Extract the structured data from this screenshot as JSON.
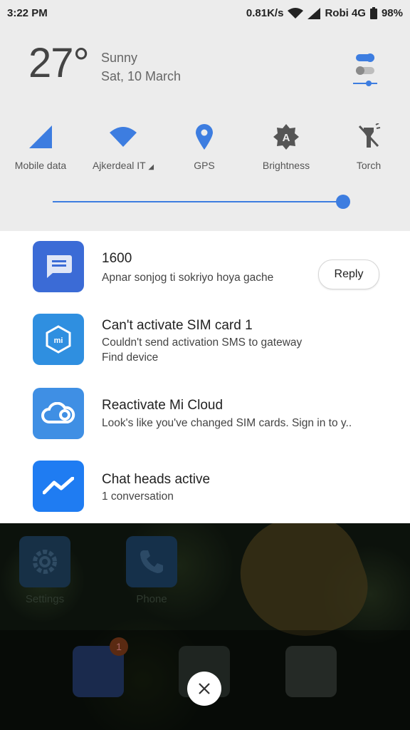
{
  "status_bar": {
    "time": "3:22 PM",
    "net_speed": "0.81K/s",
    "carrier": "Robi 4G",
    "battery": "98%"
  },
  "weather": {
    "temperature": "27°",
    "condition": "Sunny",
    "date": "Sat, 10 March"
  },
  "quick_settings": [
    {
      "label": "Mobile data",
      "icon": "mobile-data-icon"
    },
    {
      "label": "Ajkerdeal IT",
      "icon": "wifi-icon"
    },
    {
      "label": "GPS",
      "icon": "location-pin-icon"
    },
    {
      "label": "Brightness",
      "icon": "auto-brightness-icon"
    },
    {
      "label": "Torch",
      "icon": "torch-icon"
    }
  ],
  "brightness": {
    "level": 0.97,
    "accent": "#3d7de0"
  },
  "notifications": [
    {
      "title": "1600",
      "text": "Apnar sonjog ti sokriyo hoya gache",
      "action": "Reply",
      "icon": "messages-icon",
      "color": "#3b6bd6"
    },
    {
      "title": "Can't activate SIM card 1",
      "text": "Couldn't send activation SMS to gateway",
      "text2": "Find device",
      "icon": "mi-icon",
      "color": "#2f8fe0"
    },
    {
      "title": "Reactivate Mi Cloud",
      "text": "Look's like you've changed SIM cards. Sign in to y..",
      "icon": "cloud-icon",
      "color": "#3f8fe4"
    },
    {
      "title": "Chat heads active",
      "text": "1 conversation",
      "icon": "messenger-icon",
      "color": "#1f7cf2"
    }
  ],
  "home_apps": [
    {
      "label": "Settings",
      "icon": "gear-icon"
    },
    {
      "label": "Phone",
      "icon": "phone-icon"
    }
  ],
  "dock_badge": "1"
}
